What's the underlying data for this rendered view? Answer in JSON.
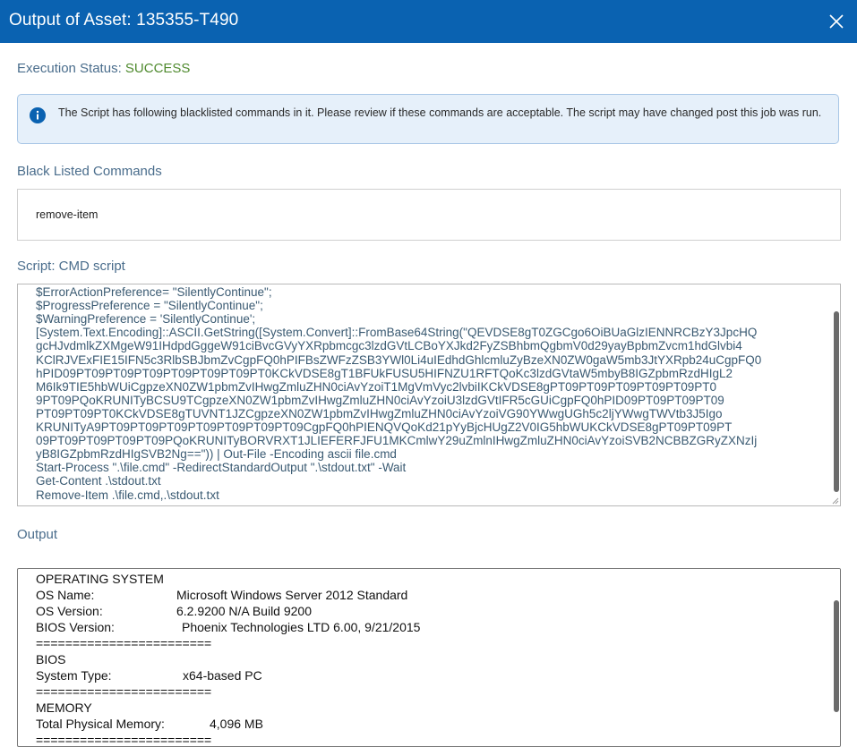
{
  "header": {
    "title": "Output of Asset: 135355-T490",
    "close_icon": "close-icon",
    "background": "#0a62b1"
  },
  "execution": {
    "label": "Execution Status:",
    "value": "SUCCESS",
    "value_color": "#4f8a2e"
  },
  "banner": {
    "icon": "info-icon",
    "message": "The Script has following blacklisted commands in it. Please review if these commands are acceptable. The script may have changed post this job was run."
  },
  "blacklisted": {
    "label": "Black Listed Commands",
    "items": [
      "remove-item"
    ]
  },
  "script": {
    "label": "Script: CMD script",
    "content": "$ErrorActionPreference= \"SilentlyContinue\";\n$ProgressPreference = \"SilentlyContinue\";\n$WarningPreference = 'SilentlyContinue';\n[System.Text.Encoding]::ASCII.GetString([System.Convert]::FromBase64String(\"QEVDSE8gT0ZGCgo6OiBUaGlzIENNRCBzY3JpcHQgcHJvdmlkZXMgeW91IHdpdGggeW91ciBvcGVyYXRpbmcgc3lzdGVtLCBoYXJkd2FyZSBhbmQgbmV0d29yayBpbmZvcm1hdGlvbi4KClRJVExFIE15IFN5c3RlbSBJbmZvCgpFQ0hPIFBsZWFzZSB3YWl0Li4uIEdhdGhlcmluZyBzeXN0ZW0gaW5mb3JtYXRpb24uCgpFQ0hPID09PT09PT09PT09PT09PT09PT09PT0KCkVDSE8gT1BFUkFUSU5HIFNZU1RFTQoKc3lzdGVtaW5mbyB8IGZpbmRzdHIgL2M6IlN5c3RlbSBUeXBlIjoKCKVDSE8gPT09PT09PT09PT09PT09PT09PT09PT0KCkVDSE8gTUVNT1JZCgpzeXN0ZW1pbmZvIHwgZmluZHN0ciAvYzoiVG90YWwgUGh5c2ljYWwgTWVtb3J5Ijo=\")) | Out-File -Encoding ascii file.cmd\nStart-Process \".\\file.cmd\" -RedirectStandardOutput \".\\stdout.txt\" -Wait\nGet-Content .\\stdout.txt\nRemove-Item .\\file.cmd,.\\stdout.txt",
    "visible_lines": [
      "$ErrorActionPreference= \"SilentlyContinue\";",
      "$ProgressPreference = \"SilentlyContinue\";",
      "$WarningPreference = 'SilentlyContinue';",
      "[System.Text.Encoding]::ASCII.GetString([System.Convert]::FromBase64String(\"QEVDSE8gT0ZGCgo6OiBUaGlzIENNRCBzY3JpcHQ",
      "gcHJvdmlkZXMgeW91IHdpdGggeW91ciBvcGVyYXRpbmcgc3lzdGVtLCBoYXJkd2FyZSBhbmQgbmV0d29yayBpbmZvcm1hdGlvbi4",
      "KClRJVExFIE15IFN5c3RlbSBJbmZvCgpFQ0hPIFBsZWFzZSB3YWl0Li4uIEdhdGhlcmluZyBzeXN0ZW0gaW5mb3JtYXRpb24uCgpFQ0",
      "hPID09PT09PT09PT09PT09PT09PT09PT0KCkVDSE8gT1BFUkFUSU5HIFNZU1RFTQoKc3lzdGVtaW5mbyB8IGZpbmRzdHIgL2",
      "M6Ik9TIE5hbWUiCgpzeXN0ZW1pbmZvIHwgZmluZHN0ciAvYzoiT1MgVmVyc2lvbiIKCkVDSE8gPT09PT09PT09PT09PT09PT0",
      "9PT09PQoKRUNITyBCSU9TCgpzeXN0ZW1pbmZvIHwgZmluZHN0ciAvYzoiU3lzdGVtIFR5cGUiCgpFQ0hPID09PT09PT09PT09",
      "PT09PT09PT0KCkVDSE8gTUVNT1JZCgpzeXN0ZW1pbmZvIHwgZmluZHN0ciAvYzoiVG90YWwgUGh5c2ljYWwgTWVtb3J5Igo",
      "KRUNITyA9PT09PT09PT09PT09PT09PT09PT09CgpFQ0hPIENQVQoKd21pYyBjcHUgZ2V0IG5hbWUKCkVDSE8gPT09PT09PT",
      "09PT09PT09PT09PT09PQoKRUNITyBORVRXT1JLIEFERFJFU1MKCmlwY29uZmlnIHwgZmluZHN0ciAvYzoiSVB2NCBBZGRyZXNzIj",
      "yB8IGZpbmRzdHIgSVB2Ng==\")) | Out-File -Encoding ascii file.cmd",
      "Start-Process \".\\file.cmd\" -RedirectStandardOutput \".\\stdout.txt\" -Wait",
      "Get-Content .\\stdout.txt",
      "Remove-Item .\\file.cmd,.\\stdout.txt"
    ]
  },
  "output": {
    "label": "Output",
    "lines": [
      {
        "key": "OPERATING SYSTEM",
        "value": ""
      },
      {
        "key": "OS Name:",
        "value": "Microsoft Windows Server 2012 Standard"
      },
      {
        "key": "OS Version:",
        "value": "6.2.9200 N/A Build 9200"
      },
      {
        "key": "BIOS Version:",
        "value": "Phoenix Technologies LTD 6.00, 9/21/2015"
      },
      {
        "key": "========================",
        "value": ""
      },
      {
        "key": "BIOS",
        "value": ""
      },
      {
        "key": "System Type:",
        "value": "x64-based PC"
      },
      {
        "key": "========================",
        "value": ""
      },
      {
        "key": "MEMORY",
        "value": ""
      },
      {
        "key": "Total Physical Memory:",
        "value": "4,096 MB"
      },
      {
        "key": "========================",
        "value": ""
      }
    ]
  }
}
